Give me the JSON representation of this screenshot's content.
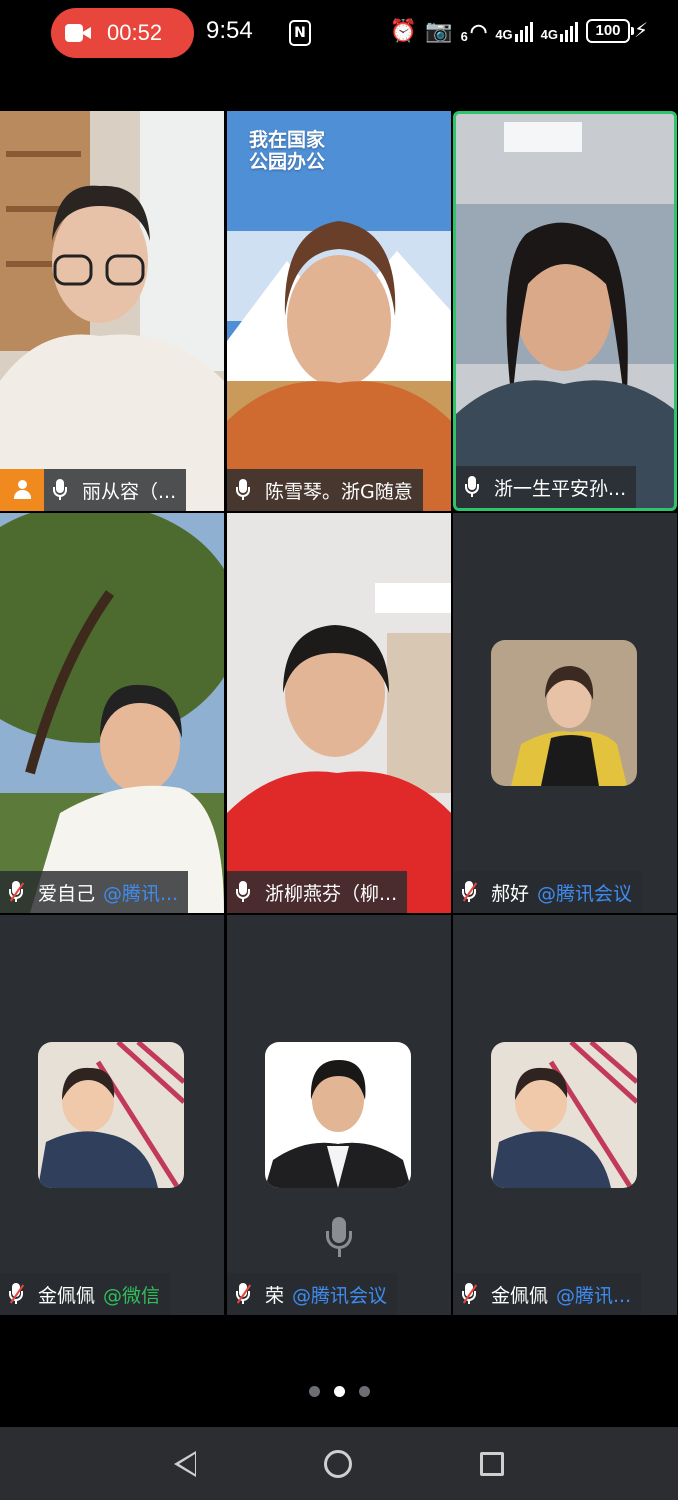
{
  "statusbar": {
    "recording_time": "00:52",
    "clock": "9:54",
    "nfc": "N",
    "signal1_label": "4G",
    "signal2_label": "4G",
    "wifi_label": "6",
    "battery": "100"
  },
  "participants": [
    {
      "name": "丽从容（...",
      "app": "",
      "muted": false,
      "host": true,
      "speaking": false,
      "view": "video"
    },
    {
      "name": "陈雪琴。浙G随意",
      "app": "",
      "muted": false,
      "host": false,
      "speaking": false,
      "view": "video"
    },
    {
      "name": "浙一生平安孙...",
      "app": "",
      "muted": false,
      "host": false,
      "speaking": true,
      "view": "video"
    },
    {
      "name": "爱自己",
      "app": "@腾讯...",
      "muted": true,
      "host": false,
      "speaking": false,
      "view": "video"
    },
    {
      "name": "浙柳燕芬（柳...",
      "app": "",
      "muted": false,
      "host": false,
      "speaking": false,
      "view": "video"
    },
    {
      "name": "郝好",
      "app": "@腾讯会议",
      "muted": true,
      "host": false,
      "speaking": false,
      "view": "avatar"
    },
    {
      "name": "金佩佩",
      "app": "@微信",
      "muted": true,
      "host": false,
      "speaking": false,
      "view": "avatar"
    },
    {
      "name": "荣",
      "app": "@腾讯会议",
      "muted": true,
      "host": false,
      "speaking": false,
      "view": "avatar"
    },
    {
      "name": "金佩佩",
      "app": "@腾讯...",
      "muted": true,
      "host": false,
      "speaking": false,
      "view": "avatar"
    }
  ],
  "video_background_text": {
    "tile2_sign": "我在国家\n公园办公"
  },
  "pager": {
    "pages": 3,
    "current": 2
  },
  "colors": {
    "recording": "#e8453c",
    "speaking_border": "#2ec46b",
    "host_badge": "#f08a1f",
    "tencent_app": "#3f8cf0",
    "wechat_app": "#2fbf5b"
  }
}
